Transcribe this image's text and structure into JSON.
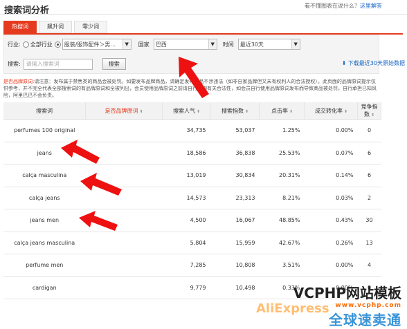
{
  "page": {
    "title": "搜索词分析",
    "help_text": "看不懂图表在说什么？",
    "help_link": "这里解答"
  },
  "tabs": [
    "热搜词",
    "飙升词",
    "零少词"
  ],
  "filters": {
    "industry_label": "行业:",
    "all_industry": "全部行业",
    "industry_value": "服装/服饰配件＞男...",
    "country_label": "国家",
    "country_value": "巴西",
    "time_label": "时间",
    "time_value": "最近30天",
    "search_label": "搜索:",
    "search_placeholder": "请输入搜索词",
    "search_button": "搜索",
    "download": "下载最近30天原始数据"
  },
  "notice": {
    "red": "是否品牌原词:",
    "text": "请注意：发布属于禁售类的商品会被处罚。如要发布品牌商品，请确定发布产品不涉违法（如非自家品牌但又未有权利人的合法授权）。此页面的品牌原词提示仅供参考，并不完全代表全部搜索词的有品牌原词和全被列出，会员使用品牌原词之前请自行查询有关合法性，如会员自行使用品牌原词发布而导致商品被处罚，自行承担已知风险，阿里巴巴不会负责。"
  },
  "table": {
    "headers": [
      "搜索词",
      "是否品牌原词",
      "搜索人气",
      "搜索指数",
      "点击率",
      "成交转化率",
      "竞争指数"
    ],
    "rows": [
      [
        "perfumes 100 original",
        "",
        "34,735",
        "53,037",
        "1.25%",
        "0.00%",
        "0"
      ],
      [
        "jeans",
        "",
        "18,586",
        "36,838",
        "25.53%",
        "0.07%",
        "6"
      ],
      [
        "calça masculina",
        "",
        "13,019",
        "30,834",
        "20.31%",
        "0.14%",
        "6"
      ],
      [
        "calça jeans",
        "",
        "14,573",
        "23,313",
        "8.21%",
        "0.03%",
        "2"
      ],
      [
        "jeans men",
        "",
        "4,500",
        "16,067",
        "48.85%",
        "0.43%",
        "30"
      ],
      [
        "calça jeans masculina",
        "",
        "5,804",
        "15,959",
        "42.67%",
        "0.26%",
        "13"
      ],
      [
        "perfume men",
        "",
        "7,285",
        "10,808",
        "3.51%",
        "0.00%",
        "4"
      ],
      [
        "cardigan",
        "",
        "9,779",
        "10,498",
        "0.33%",
        "0.00%",
        "0"
      ]
    ]
  },
  "watermark": {
    "line1": "VCPHP网站模板",
    "line2": "www.vcphp.com",
    "line3": "全球速卖通",
    "logo": "AliExpress"
  },
  "colors": {
    "accent": "#e63a1f",
    "link": "#1a66c5",
    "arrow": "#ee1111"
  }
}
